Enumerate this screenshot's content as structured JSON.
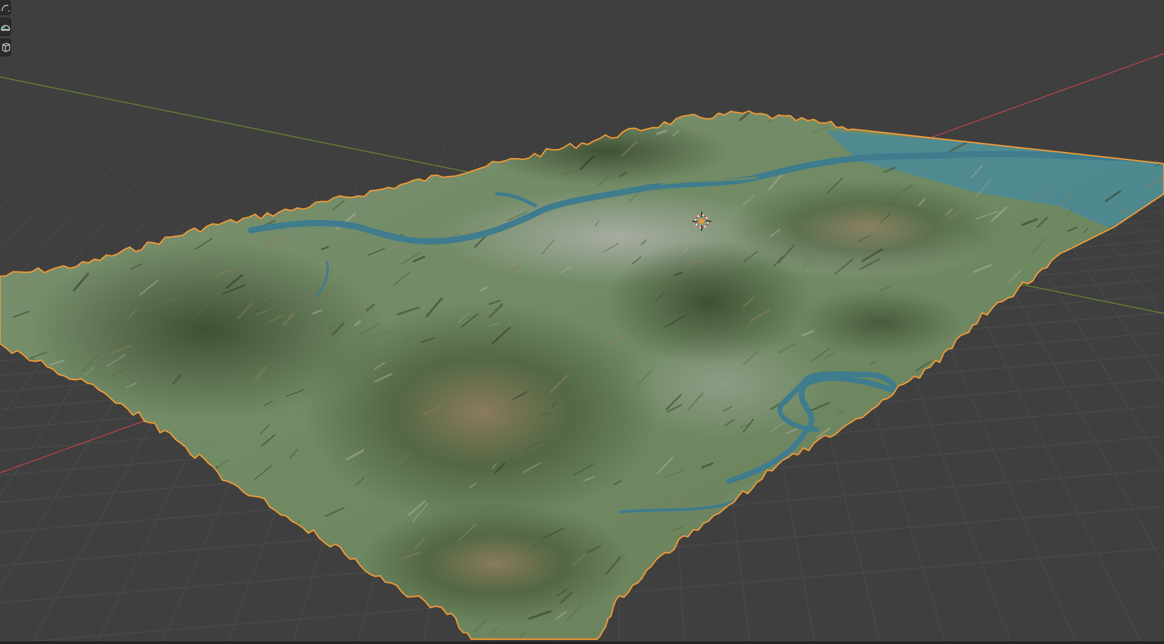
{
  "app": {
    "name": "3D Viewport"
  },
  "toolbar": {
    "tools": [
      {
        "name": "transform-tool",
        "icon": "transform-icon"
      },
      {
        "name": "measure-tool",
        "icon": "protractor-icon"
      },
      {
        "name": "add-cube-tool",
        "icon": "add-cube-icon"
      }
    ]
  },
  "scene": {
    "object": "terrain-mesh",
    "selected": true,
    "selection_outline_color": "#f29a35",
    "axis_colors": {
      "x": "#c9454b",
      "y": "#6a8e32"
    },
    "grid_color": "#4d4d4d",
    "background_color": "#3f3f3f",
    "terrain_colors": {
      "vegetation": "#6d8a5f",
      "mountain": "#556b45",
      "ridge_shadow": "#2f3a26",
      "urban": "#9aa199",
      "river": "#3e7c8e",
      "sea": "#4a8a99"
    },
    "origin_marker": "origin-icon"
  }
}
